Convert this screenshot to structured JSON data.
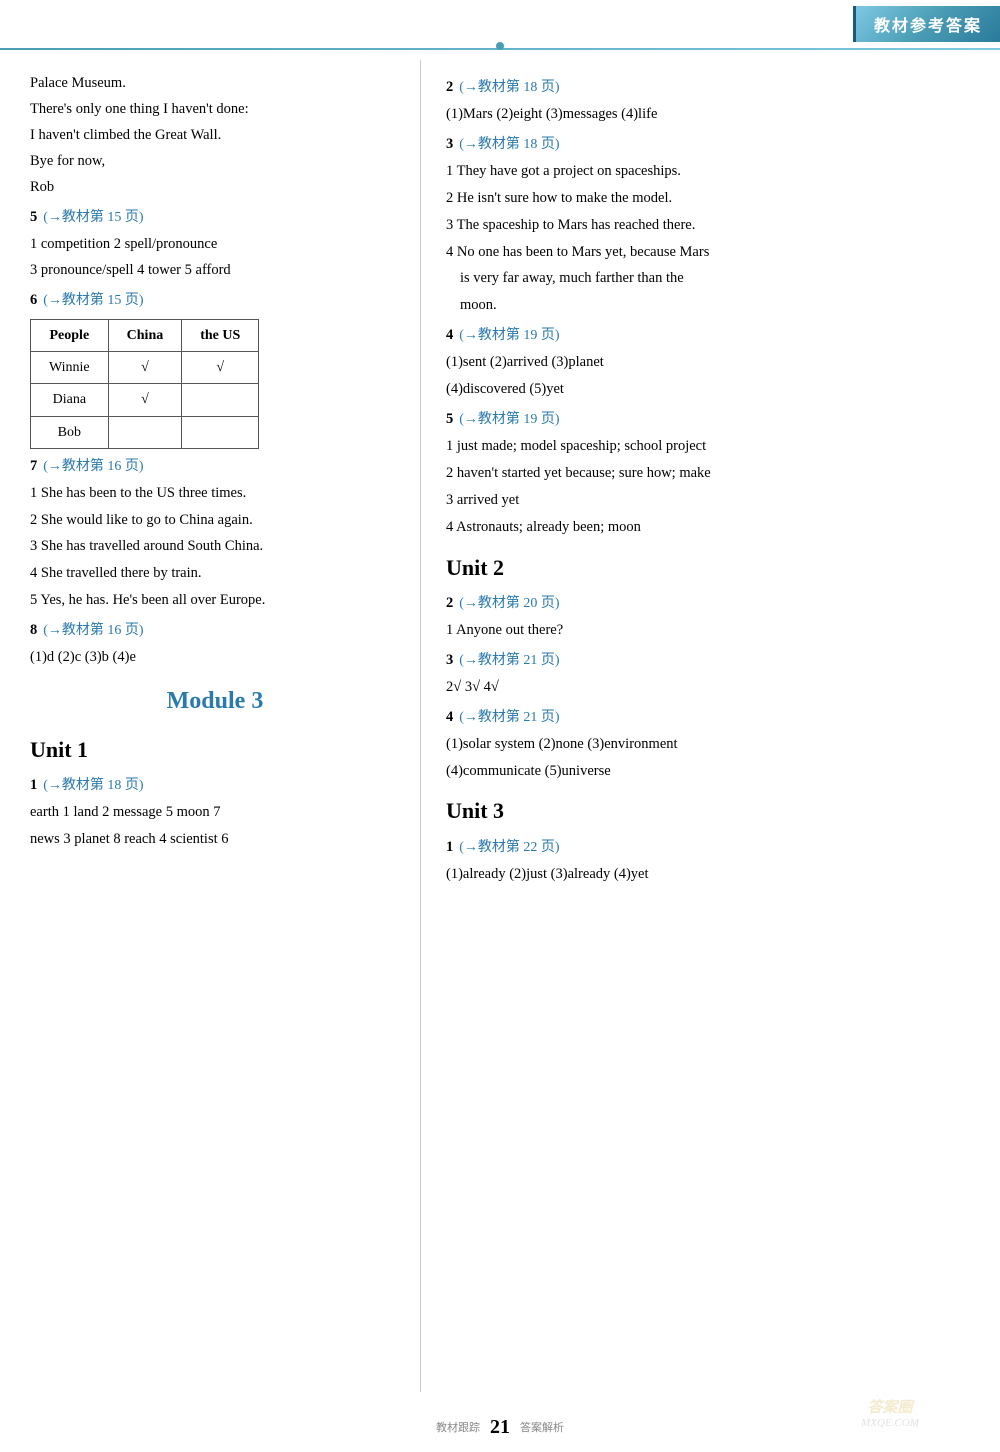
{
  "header": {
    "label": "教材参考答案"
  },
  "page_number": "21",
  "bottom_left": "教材跟踪",
  "bottom_right": "答案解析",
  "left_column": {
    "intro_lines": [
      "Palace Museum.",
      "There's only one thing I haven't done:",
      "I haven't climbed the Great Wall.",
      "Bye for now,",
      "Rob"
    ],
    "section5": {
      "num": "5",
      "ref": "(→教材第 15 页)",
      "lines": [
        "1 competition  2 spell/pronounce",
        "3 pronounce/spell  4 tower  5 afford"
      ]
    },
    "section6": {
      "num": "6",
      "ref": "(→教材第 15 页)",
      "table": {
        "headers": [
          "People",
          "China",
          "the US"
        ],
        "rows": [
          {
            "name": "Winnie",
            "china": "√",
            "us": "√"
          },
          {
            "name": "Diana",
            "china": "√",
            "us": ""
          },
          {
            "name": "Bob",
            "china": "",
            "us": ""
          }
        ]
      }
    },
    "section7": {
      "num": "7",
      "ref": "(→教材第 16 页)",
      "lines": [
        "1 She has been to the US three times.",
        "2 She would like to go to China again.",
        "3 She has travelled around South China.",
        "4 She travelled there by train.",
        "5 Yes, he has. He's been all over Europe."
      ]
    },
    "section8": {
      "num": "8",
      "ref": "(→教材第 16 页)",
      "lines": [
        "(1)d   (2)c   (3)b   (4)e"
      ]
    },
    "module3": {
      "title": "Module 3"
    },
    "unit1_left": {
      "title": "Unit 1"
    },
    "section1_left": {
      "num": "1",
      "ref": "(→教材第 18 页)",
      "lines": [
        "earth 1  land 2  message 5  moon 7",
        "news 3  planet 8  reach 4  scientist 6"
      ]
    }
  },
  "right_column": {
    "section2_right": {
      "num": "2",
      "ref": "(→教材第 18 页)",
      "lines": [
        "(1)Mars  (2)eight  (3)messages  (4)life"
      ]
    },
    "section3_right": {
      "num": "3",
      "ref": "(→教材第 18 页)",
      "lines": [
        "1 They have got a project on spaceships.",
        "2 He isn't sure how to make the model.",
        "3 The spaceship to Mars has reached there.",
        "4 No one has been to Mars yet, because Mars",
        "  is very far away, much farther than the",
        "  moon."
      ]
    },
    "section4_right": {
      "num": "4",
      "ref": "(→教材第 19 页)",
      "lines": [
        "(1)sent  (2)arrived  (3)planet",
        "(4)discovered  (5)yet"
      ]
    },
    "section5_right": {
      "num": "5",
      "ref": "(→教材第 19 页)",
      "lines": [
        "1 just made; model spaceship; school project",
        "2 haven't started yet because; sure how; make",
        "3 arrived yet",
        "4 Astronauts; already been; moon"
      ]
    },
    "unit2": {
      "title": "Unit 2"
    },
    "section2_u2": {
      "num": "2",
      "ref": "(→教材第 20 页)",
      "lines": [
        "1 Anyone out there?"
      ]
    },
    "section3_u2": {
      "num": "3",
      "ref": "(→教材第 21 页)",
      "lines": [
        "2√  3√  4√"
      ]
    },
    "section4_u2": {
      "num": "4",
      "ref": "(→教材第 21 页)",
      "lines": [
        "(1)solar system  (2)none  (3)environment",
        "(4)communicate  (5)universe"
      ]
    },
    "unit3": {
      "title": "Unit 3"
    },
    "section1_u3": {
      "num": "1",
      "ref": "(→教材第 22 页)",
      "lines": [
        "(1)already  (2)just  (3)already  (4)yet"
      ]
    }
  }
}
